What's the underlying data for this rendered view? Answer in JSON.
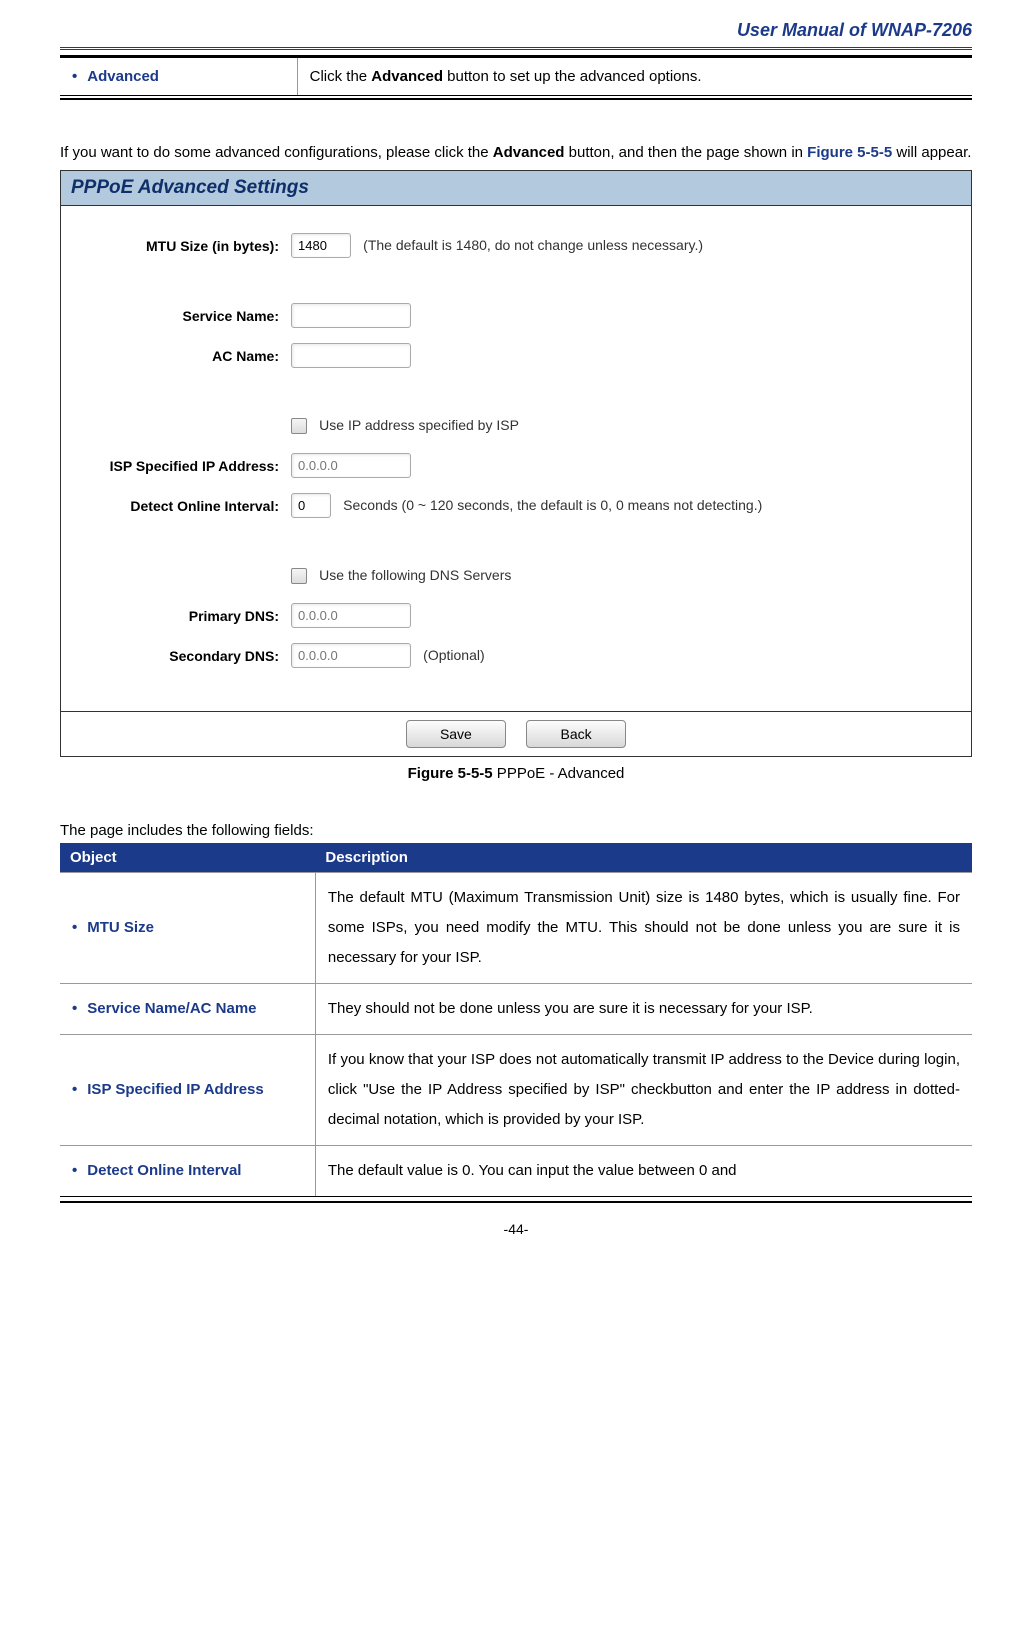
{
  "header": {
    "title": "User Manual of WNAP-7206"
  },
  "advRow": {
    "label": "Advanced",
    "desc_pre": "Click the ",
    "desc_bold": "Advanced",
    "desc_post": " button to set up the advanced options."
  },
  "para": {
    "p1_pre": "If you want to do some advanced configurations, please click the ",
    "p1_bold": "Advanced",
    "p1_post": " button, and then the page shown in ",
    "figref": "Figure 5-5-5",
    "p1_end": " will appear."
  },
  "panel": {
    "title": "PPPoE Advanced Settings",
    "mtu_label": "MTU Size (in bytes):",
    "mtu_value": "1480",
    "mtu_note": "(The default is 1480, do not change unless necessary.)",
    "service_label": "Service Name:",
    "ac_label": "AC Name:",
    "use_ip_label": "Use IP address specified by ISP",
    "isp_ip_label": "ISP Specified IP Address:",
    "isp_ip_placeholder": "0.0.0.0",
    "detect_label": "Detect Online Interval:",
    "detect_value": "0",
    "detect_note": "Seconds (0 ~ 120 seconds, the default is 0, 0 means not detecting.)",
    "use_dns_label": "Use the following DNS Servers",
    "primary_dns_label": "Primary DNS:",
    "primary_dns_placeholder": "0.0.0.0",
    "secondary_dns_label": "Secondary DNS:",
    "secondary_dns_placeholder": "0.0.0.0",
    "optional": "(Optional)",
    "save": "Save",
    "back": "Back"
  },
  "caption": {
    "bold": "Figure 5-5-5",
    "rest": " PPPoE - Advanced"
  },
  "fieldsIntro": "The page includes the following fields:",
  "fieldsHeader": {
    "object": "Object",
    "description": "Description"
  },
  "fields": [
    {
      "obj": "MTU Size",
      "desc": "The default MTU (Maximum Transmission Unit) size is 1480 bytes, which is usually fine. For some ISPs, you need modify the MTU. This should not be done unless you are sure it is necessary for your ISP."
    },
    {
      "obj": "Service Name/AC Name",
      "desc": "They should not be done unless you are sure it is necessary for your ISP."
    },
    {
      "obj": "ISP Specified IP Address",
      "desc": "If you know that your ISP does not automatically transmit IP address to the Device during login, click \"Use the IP Address specified by ISP\" checkbutton and enter the IP address in dotted-decimal notation, which is provided by your ISP."
    },
    {
      "obj": "Detect Online Interval",
      "desc": "The default value is 0. You can input the value between 0 and"
    }
  ],
  "pageNum": "-44-"
}
